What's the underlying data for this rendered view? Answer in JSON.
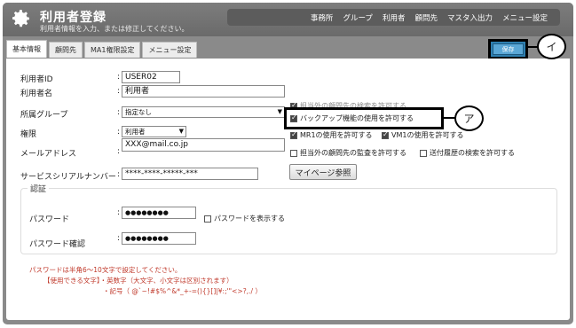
{
  "header": {
    "title": "利用者登録",
    "subtitle": "利用者情報を入力、または修正してください。",
    "nav": [
      "事務所",
      "グループ",
      "利用者",
      "顧問先",
      "マスタ入出力",
      "メニュー設定"
    ]
  },
  "tabs": [
    "基本情報",
    "顧問先",
    "MA1権限設定",
    "メニュー設定"
  ],
  "save_label": "保存",
  "form": {
    "user_id_label": "利用者ID",
    "user_id_value": "USER02",
    "user_name_label": "利用者名",
    "user_name_value": "利用者",
    "group_label": "所属グループ",
    "group_value": "指定なし",
    "authority_label": "権限",
    "authority_value": "利用者",
    "email_label": "メールアドレス",
    "email_value": "XXX@mail.co.jp",
    "serial_label": "サービスシリアルナンバー",
    "serial_value": "****-****-*****-***",
    "mypage_button": "マイページ参照"
  },
  "checks": {
    "outside_search": "担当外の顧問先の検索を許可する",
    "backup": "バックアップ機能の使用を許可する",
    "mr1": "MR1の使用を許可する",
    "vm1": "VM1の使用を許可する",
    "outside_audit": "担当外の顧問先の監査を許可する",
    "send_history": "送付履歴の検索を許可する"
  },
  "auth": {
    "legend": "認証",
    "password_label": "パスワード",
    "password_value": "●●●●●●●●",
    "show_password": "パスワードを表示する",
    "confirm_label": "パスワード確認",
    "confirm_value": "●●●●●●●●"
  },
  "notes": {
    "line1": "パスワードは半角6～10文字で設定してください。",
    "line2": "【使用できる文字】・英数字（大文字、小文字は区別されます）",
    "line3": "・記号（ @`~!#$%^&*_+-=(){}[]|¥:;'\"<>?,./ ）"
  },
  "callouts": {
    "a": "ア",
    "i": "イ"
  }
}
